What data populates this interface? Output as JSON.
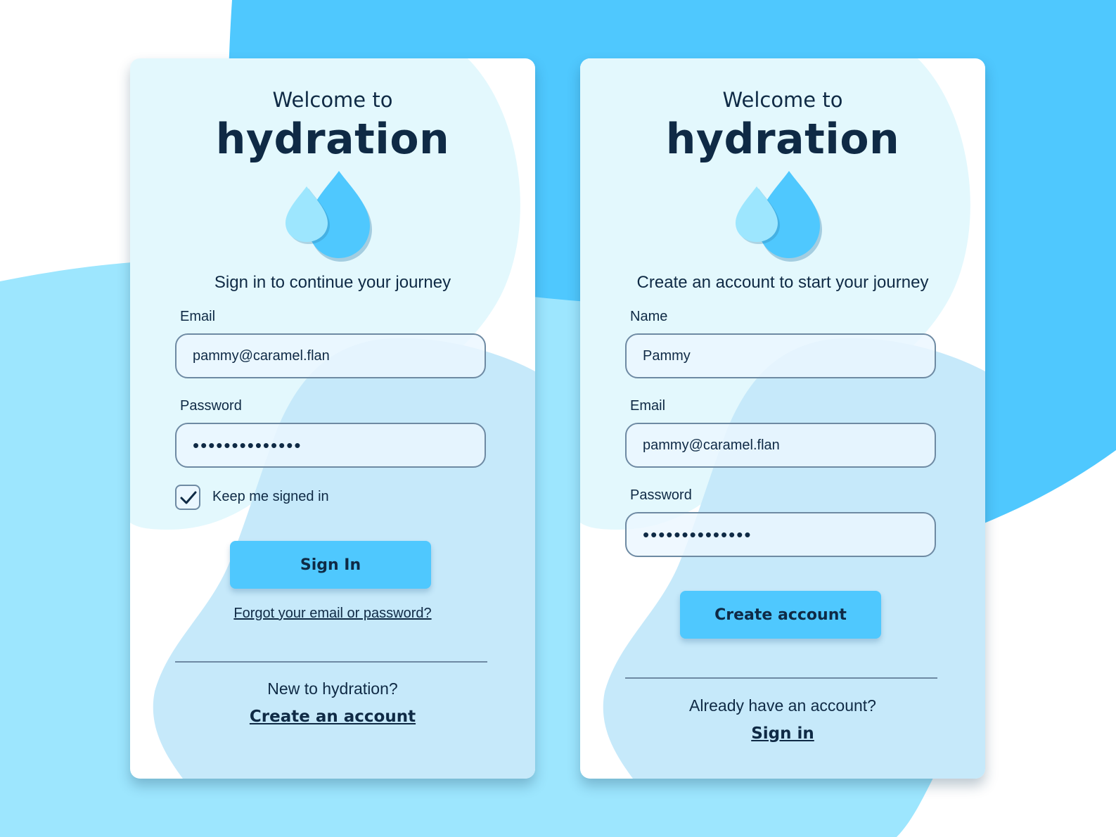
{
  "colors": {
    "accent": "#4fc8fe",
    "accent_light": "#9de6fe",
    "text": "#0f2a45",
    "field_border": "#6e8aa3"
  },
  "signin_card": {
    "welcome": "Welcome to",
    "brand": "hydration",
    "logo_icon": "water-drops-icon",
    "subtitle": "Sign in to continue your journey",
    "email_label": "Email",
    "email_value": "pammy@caramel.flan",
    "password_label": "Password",
    "password_value": "••••••••••••••",
    "keep_signed_in_label": "Keep me signed in",
    "keep_signed_in_checked": true,
    "submit_label": "Sign In",
    "forgot_link": "Forgot your email or password?",
    "footer_prompt": "New to hydration?",
    "footer_link": "Create an account"
  },
  "signup_card": {
    "welcome": "Welcome to",
    "brand": "hydration",
    "logo_icon": "water-drops-icon",
    "subtitle": "Create an account to start your journey",
    "name_label": "Name",
    "name_value": "Pammy",
    "email_label": "Email",
    "email_value": "pammy@caramel.flan",
    "password_label": "Password",
    "password_value": "••••••••••••••",
    "submit_label": "Create account",
    "footer_prompt": "Already have an account?",
    "footer_link": "Sign in"
  }
}
